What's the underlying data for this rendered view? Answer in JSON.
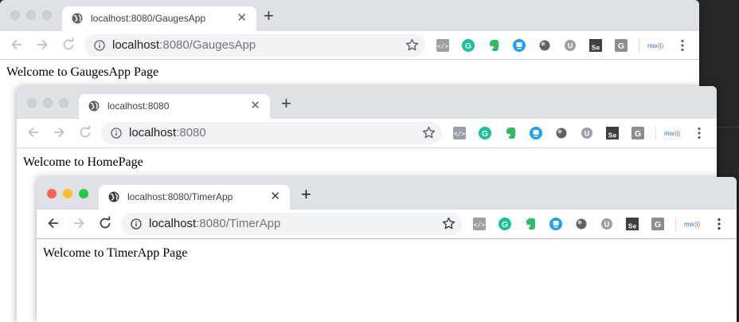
{
  "windows": [
    {
      "id": "gauges",
      "active": false,
      "tab_title": "localhost:8080/GaugesApp",
      "url_host": "localhost",
      "url_rest": ":8080/GaugesApp",
      "welcome_text": "Welcome to GaugesApp Page"
    },
    {
      "id": "home",
      "active": false,
      "tab_title": "localhost:8080",
      "url_host": "localhost",
      "url_rest": ":8080",
      "welcome_text": "Welcome to HomePage"
    },
    {
      "id": "timer",
      "active": true,
      "tab_title": "localhost:8080/TimerApp",
      "url_host": "localhost",
      "url_rest": ":8080/TimerApp",
      "welcome_text": "Welcome to TimerApp Page"
    }
  ],
  "toolbar": {
    "extensions": [
      {
        "name": "code-view-icon",
        "label": "</>",
        "color": "#9aa0a6"
      },
      {
        "name": "grammarly-icon",
        "label": "G",
        "color": "#15c39a"
      },
      {
        "name": "evernote-icon",
        "label": "",
        "color": "#2dbe60"
      },
      {
        "name": "lighthouse-icon",
        "label": "",
        "color": "#1da1f2"
      },
      {
        "name": "gray-circle-icon",
        "label": "",
        "color": "#5f6368"
      },
      {
        "name": "u-icon",
        "label": "U",
        "color": "#9aa0a6"
      },
      {
        "name": "selenium-icon",
        "label": "Se",
        "color": "#3c4043"
      },
      {
        "name": "g-square-icon",
        "label": "G",
        "color": "#8a8d91"
      },
      {
        "name": "mw-icon",
        "label": "mw(i)",
        "color": "#1a73e8"
      }
    ]
  }
}
